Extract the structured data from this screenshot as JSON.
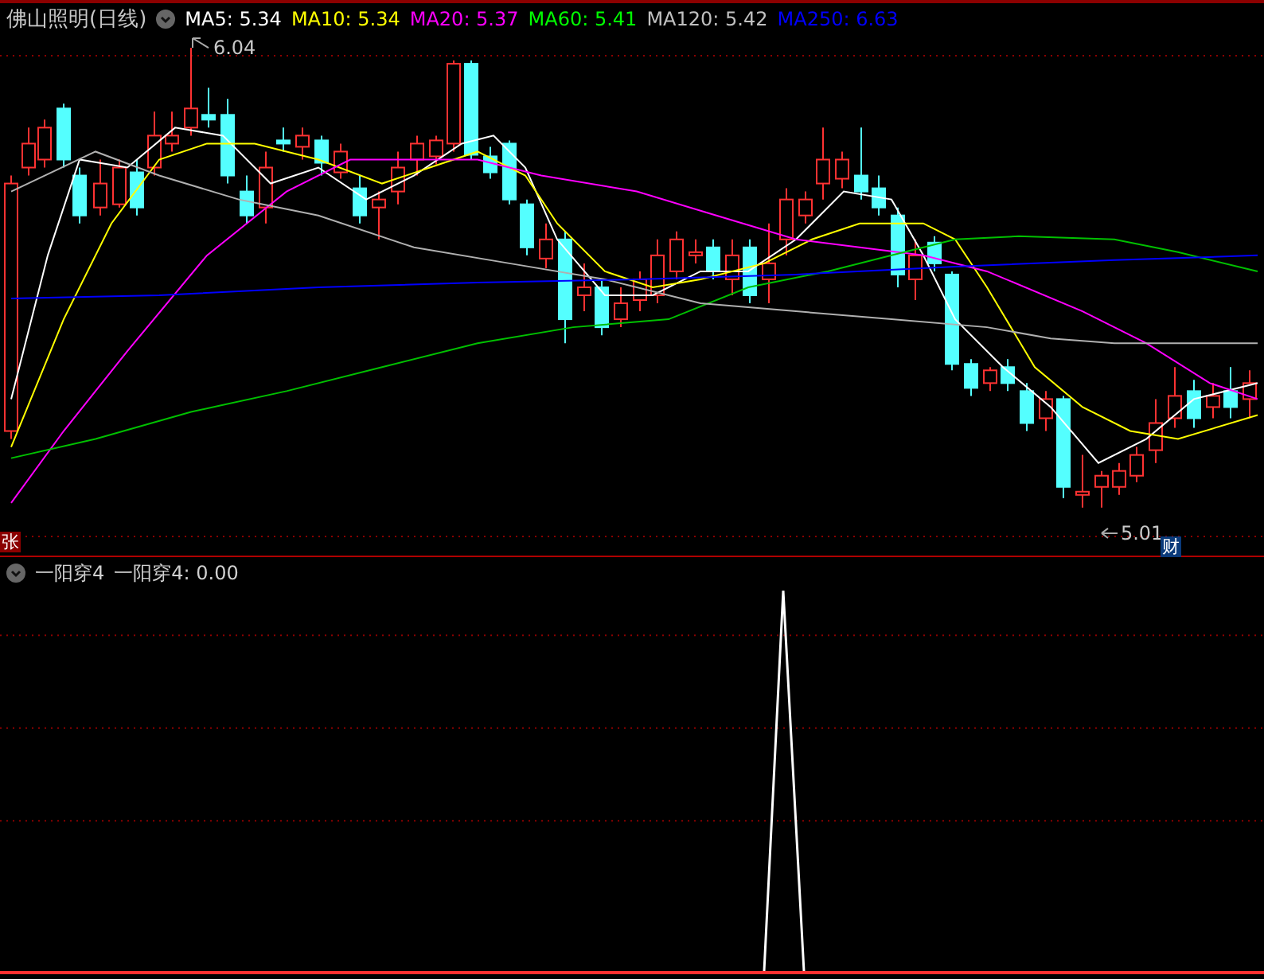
{
  "title": "佛山照明(日线)",
  "ma_legend": [
    {
      "label": "MA5: 5.34",
      "color": "#ffffff"
    },
    {
      "label": "MA10: 5.34",
      "color": "#ffff00"
    },
    {
      "label": "MA20: 5.37",
      "color": "#ff00ff"
    },
    {
      "label": "MA60: 5.41",
      "color": "#00ff00"
    },
    {
      "label": "MA120: 5.42",
      "color": "#c0c0c0"
    },
    {
      "label": "MA250: 6.63",
      "color": "#0000ff"
    }
  ],
  "price_marks": {
    "high": "6.04",
    "low": "5.01"
  },
  "badges": [
    {
      "kind": "rise",
      "text": "张"
    },
    {
      "kind": "finance",
      "text": "财"
    }
  ],
  "indicator": {
    "name": "一阳穿4",
    "reading": "一阳穿4: 0.00"
  }
}
